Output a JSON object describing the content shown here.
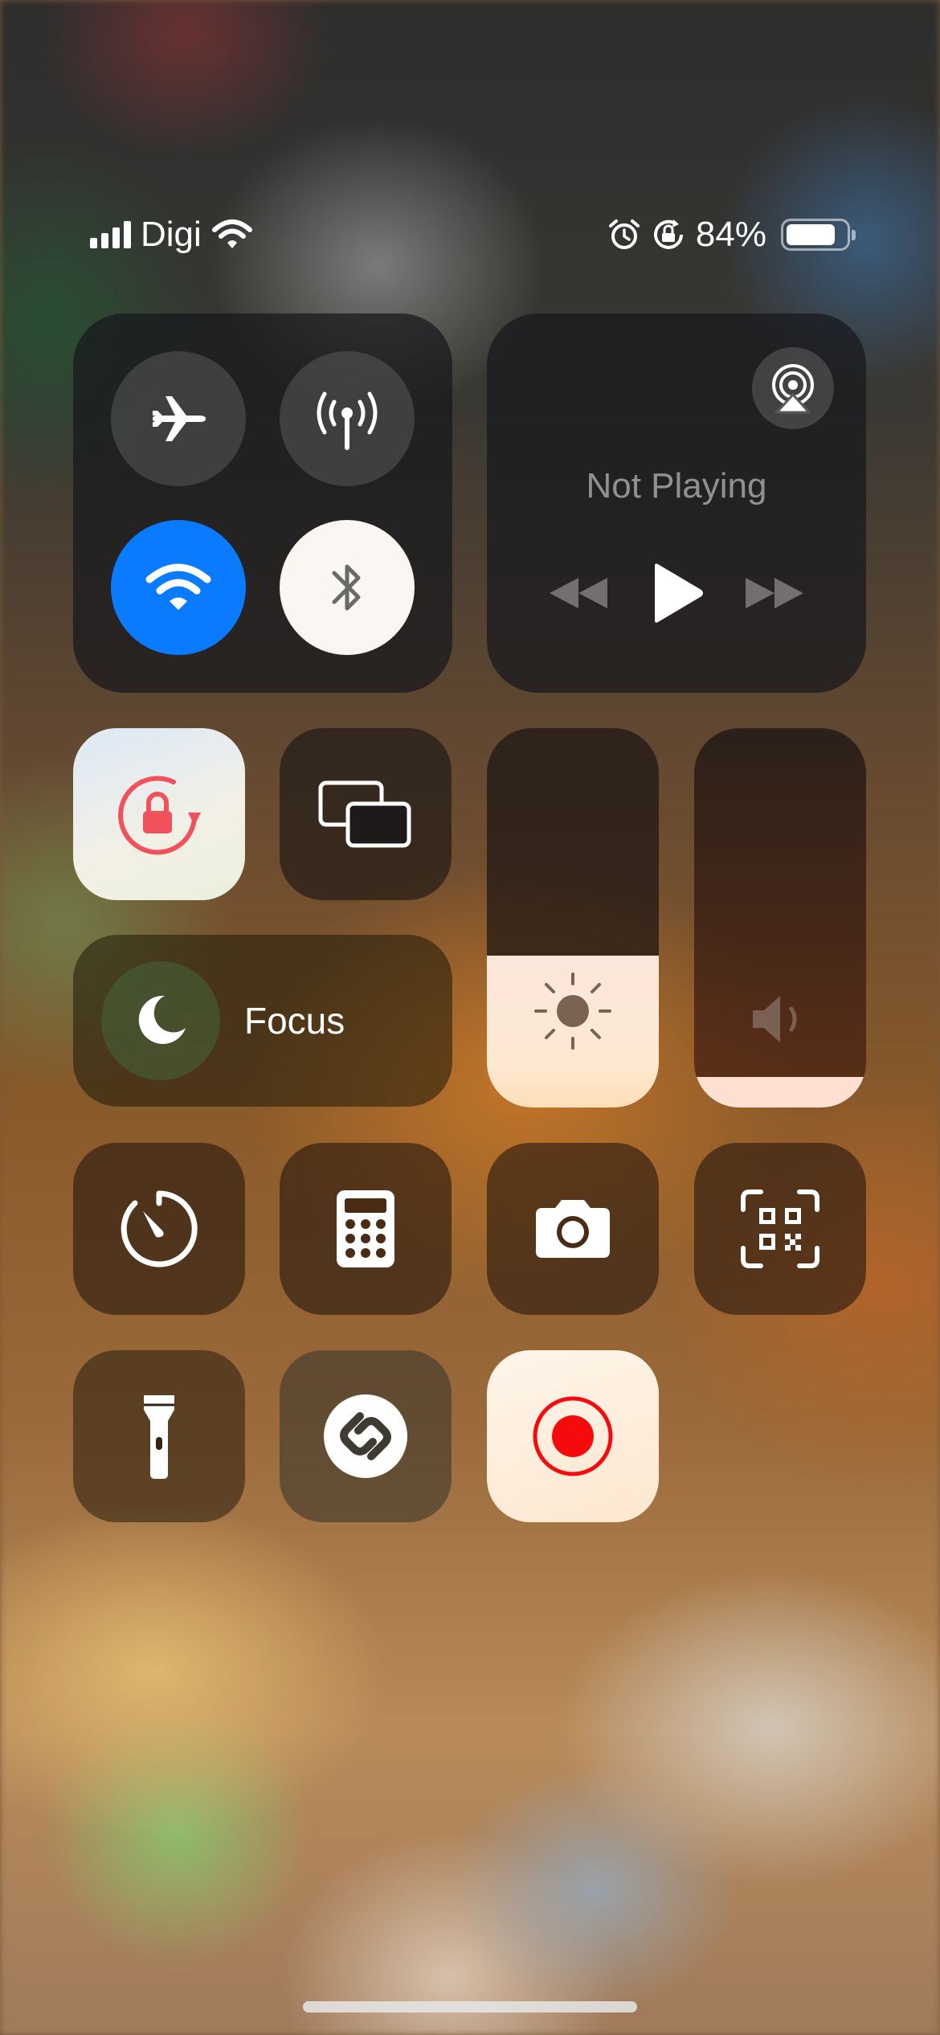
{
  "status_bar": {
    "carrier": "Digi",
    "signal_bars": 4,
    "battery_percent_label": "84%",
    "battery_level": 0.84,
    "icons": [
      "signal-icon",
      "wifi-icon",
      "alarm-icon",
      "orientation-lock-icon",
      "battery-icon"
    ]
  },
  "connectivity": {
    "airplane_mode": {
      "icon": "airplane-icon",
      "on": false
    },
    "cellular_data": {
      "icon": "antenna-icon",
      "on": false
    },
    "wifi": {
      "icon": "wifi-icon",
      "on": true,
      "accent": "#0a7aff"
    },
    "bluetooth": {
      "icon": "bluetooth-icon",
      "on": true
    }
  },
  "media": {
    "title": "Not Playing",
    "airplay_icon": "airplay-audio-icon",
    "controls": [
      "rewind-icon",
      "play-icon",
      "fast-forward-icon"
    ]
  },
  "controls": {
    "orientation_lock": {
      "icon": "orientation-lock-icon",
      "on": true,
      "accent": "#f0515a"
    },
    "screen_mirroring": {
      "icon": "screen-mirroring-icon"
    },
    "focus": {
      "label": "Focus",
      "icon": "moon-icon"
    },
    "brightness": {
      "icon": "sun-icon",
      "level": 0.4
    },
    "volume": {
      "icon": "speaker-icon",
      "level": 0.08
    }
  },
  "shortcuts": [
    {
      "name": "timer",
      "icon": "timer-icon"
    },
    {
      "name": "calculator",
      "icon": "calculator-icon"
    },
    {
      "name": "camera",
      "icon": "camera-icon"
    },
    {
      "name": "code-scanner",
      "icon": "qr-code-icon"
    },
    {
      "name": "flashlight",
      "icon": "flashlight-icon"
    },
    {
      "name": "shazam",
      "icon": "shazam-icon"
    },
    {
      "name": "screen-recording",
      "icon": "record-icon",
      "accent": "#f50b0b"
    }
  ]
}
